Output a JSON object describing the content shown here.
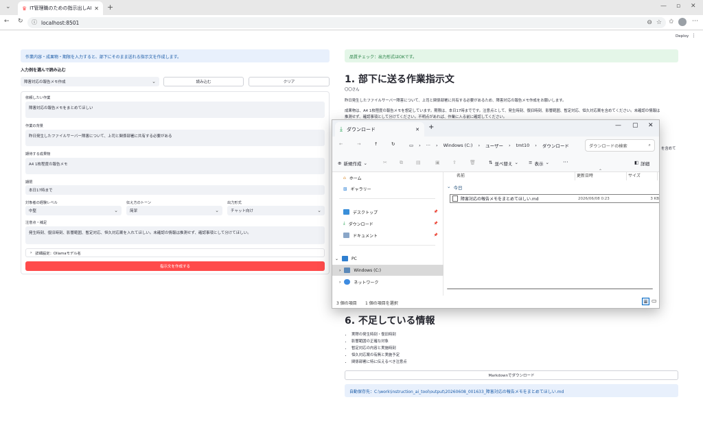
{
  "browser": {
    "tab_title": "IT管理職のための指示出しAIツール",
    "url": "localhost:8501"
  },
  "app": {
    "deploy_label": "Deploy",
    "info_banner": "作業内容・成果物・期限を入力すると、部下にそのまま送れる指示文を作成します。",
    "example_heading": "入力例を選んで読み込む",
    "example_select": "障害対応の報告メモ作成",
    "load_button": "読み込む",
    "clear_button": "クリア",
    "fields": {
      "task_label": "依頼したい作業",
      "task_value": "障害対応の報告メモをまとめてほしい",
      "background_label": "作業の背景",
      "background_value": "昨日発生したファイルサーバー障害について、上司と関係部署に共有する必要がある",
      "deliverable_label": "期待する成果物",
      "deliverable_value": "A4 1枚程度の報告メモ",
      "deadline_label": "期限",
      "deadline_value": "本日17時まで",
      "skill_label": "対象者の経験レベル",
      "skill_value": "中堅",
      "tone_label": "伝え方のトーン",
      "tone_value": "简潔",
      "format_label": "出力形式",
      "format_value": "チャット向け",
      "notes_label": "注意点・補足",
      "notes_value": "発生時刻、復旧時刻、影響範囲、暫定対応、恒久対応案を入れてほしい。未確認の情報は推測せず、確認事項として分けてほしい。"
    },
    "advanced_expander": "詳細設定：Ollamaモデル名",
    "generate_button": "指示文を作成する",
    "success_banner": "品質チェック：出力形式はOKです。",
    "heading1": "1. 部下に送る作業指示文",
    "salutation": "〇〇さん",
    "para1": "昨日発生したファイルサーバー障害について、上司と関係部署に共有する必要があるため、障害対応の報告メモ作成をお願いします。",
    "para2a": "成果物は、A4 1枚程度の報告メモを想定しています。期限は、本日17時までです。注意点として、発生時刻、復旧時刻、影響範囲、暫定対応、恒久対応案を含めてください。未確認の情報は",
    "para2b": "推測せず、確認事項として分けてください。不明点があれば、作業に入る前に確認してください。",
    "overflow_text": "を含めて",
    "heading6": "6. 不足している情報",
    "missing_items": [
      "実際の発生時刻・復旧時刻",
      "影響範囲の正確な対象",
      "暫定対応の内容と実施時刻",
      "恒久対応案の有無と実施予定",
      "関係部署に特に伝えるべき注意点"
    ],
    "download_button": "Markdownでダウンロード",
    "autosave": "自動保存先：C:\\work\\instruction_ai_tool\\output\\20260608_001633_障害対応の報告メモをまとめてほしい.md"
  },
  "explorer": {
    "tab_title": "ダウンロード",
    "path": [
      "Windows (C:)",
      "ユーザー",
      "tmt10",
      "ダウンロード"
    ],
    "search_placeholder": "ダウンロードの検索",
    "new_button": "新規作成",
    "sort_button": "並べ替え",
    "view_button": "表示",
    "more": "···",
    "details_button": "詳細",
    "sidebar": {
      "home": "ホーム",
      "gallery": "ギャラリー",
      "desktop": "デスクトップ",
      "downloads": "ダウンロード",
      "documents": "ドキュメント",
      "pc": "PC",
      "cdrive": "Windows (C:)",
      "network": "ネットワーク"
    },
    "columns": {
      "name": "名前",
      "modified": "更新日時",
      "size": "サイズ"
    },
    "group_today": "今日",
    "file": {
      "name": "障害対応の報告メモをまとめてほしい.md",
      "modified": "2026/06/08 0:23",
      "size": "3 KB"
    },
    "status_count": "3 個の項目",
    "status_selected": "1 個の項目を選択"
  },
  "colors": {
    "primary_button": "#ff4b4b",
    "info_bg": "#e8f0fc",
    "success_bg": "#e4f6e8",
    "explorer_accent": "#0067c0"
  }
}
